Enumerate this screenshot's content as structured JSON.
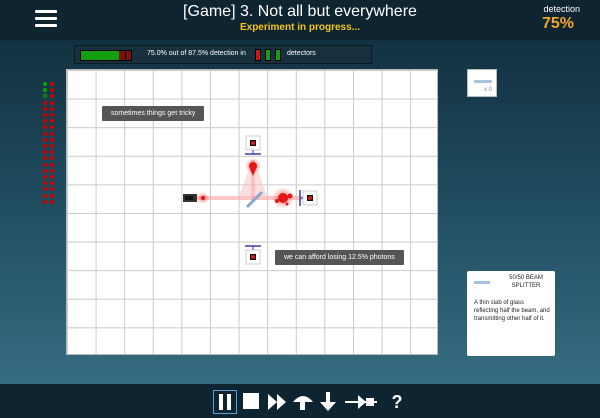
{
  "header": {
    "title": "[Game] 3. Not all but everywhere",
    "subtitle": "Experiment in progress...",
    "detection_label": "detection",
    "detection_value": "75%"
  },
  "progress": {
    "text": "75.0% out of 87.5% detection in",
    "suffix": "detectors",
    "achieved_fraction": 0.75,
    "required_fraction": 0.875,
    "detector_colors": [
      "#c81818",
      "#12a012",
      "#12a012"
    ]
  },
  "hints": {
    "hint_top": "sometimes things get tricky",
    "hint_bottom": "we can afford losing 12.5% photons"
  },
  "toolbox": {
    "item_name": "50/50 beam splitter",
    "count": "x 0"
  },
  "card": {
    "title": "50/50 BEAM SPLITTER",
    "description": "A thin slab of glass reflecting half the beam, and transmitting other half of it."
  },
  "photon_counter": {
    "used": 3,
    "remaining": 37,
    "used_colors": [
      "#0a0",
      "#0a0",
      "#0a0"
    ],
    "remaining_color": "#c00"
  },
  "controls": [
    {
      "name": "pause",
      "icon": "pause-icon"
    },
    {
      "name": "stop",
      "icon": "stop-icon"
    },
    {
      "name": "fast-forward",
      "icon": "fast-forward-icon"
    },
    {
      "name": "drop-photon",
      "icon": "mushroom-icon"
    },
    {
      "name": "download",
      "icon": "down-arrow-icon"
    },
    {
      "name": "wave-particle",
      "icon": "wave-icon"
    },
    {
      "name": "help",
      "icon": "help-icon",
      "label": "?"
    }
  ],
  "colors": {
    "accent": "#f5a623",
    "subtitle": "#f5c518",
    "laser": "#e01818"
  }
}
